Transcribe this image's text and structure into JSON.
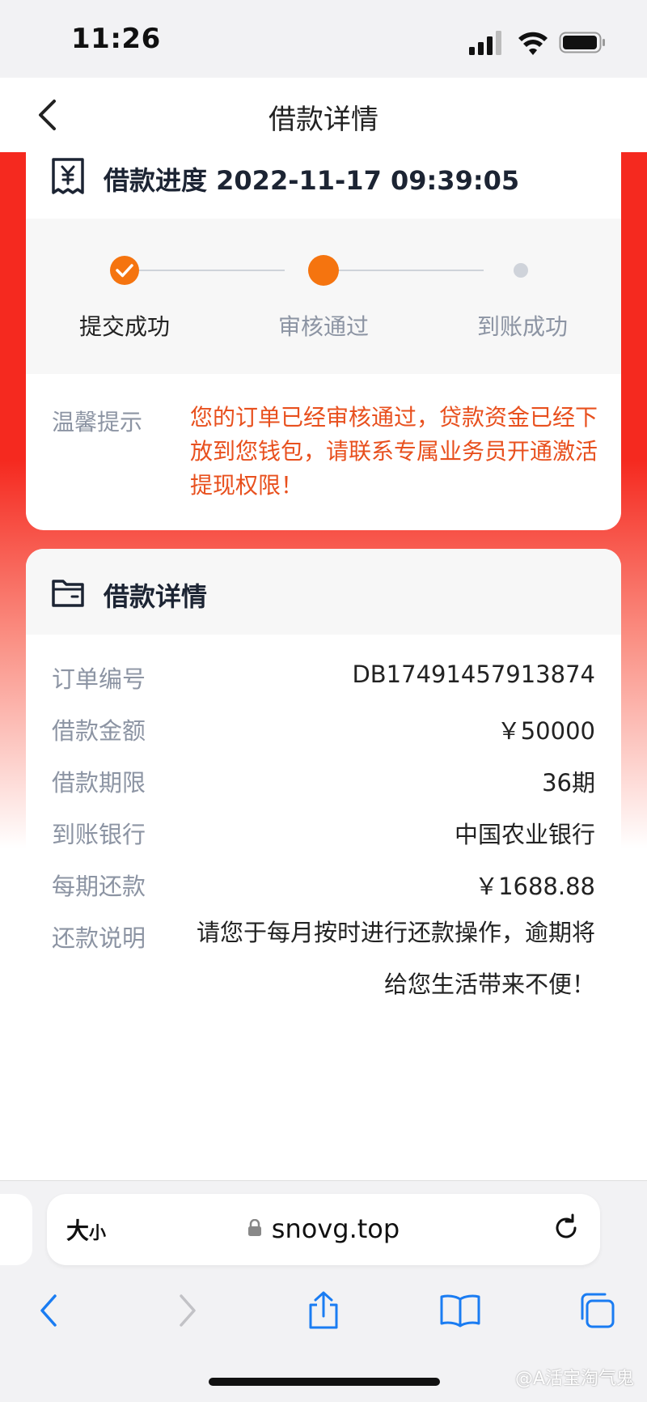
{
  "status": {
    "time": "11:26"
  },
  "nav": {
    "title": "借款详情"
  },
  "progress_card": {
    "title": "借款进度 2022-11-17 09:39:05",
    "steps": [
      {
        "label": "提交成功",
        "state": "done"
      },
      {
        "label": "审核通过",
        "state": "current"
      },
      {
        "label": "到账成功",
        "state": "pending"
      }
    ],
    "tip_label": "温馨提示",
    "tip_text": "您的订单已经审核通过，贷款资金已经下放到您钱包，请联系专属业务员开通激活提现权限！"
  },
  "detail_card": {
    "title": "借款详情",
    "rows": [
      {
        "label": "订单编号",
        "value": "DB17491457913874"
      },
      {
        "label": "借款金额",
        "value": "￥50000"
      },
      {
        "label": "借款期限",
        "value": "36期"
      },
      {
        "label": "到账银行",
        "value": "中国农业银行"
      },
      {
        "label": "每期还款",
        "value": "￥1688.88"
      },
      {
        "label": "还款说明",
        "value": "请您于每月按时进行还款操作，逾期将给您生活带来不便！"
      }
    ]
  },
  "browser": {
    "aa_big": "大",
    "aa_small": "小",
    "url": "snovg.top"
  },
  "watermark": "@A活宝淘气鬼",
  "colors": {
    "accent_orange": "#f5740f",
    "tip_red": "#e8501e",
    "background_red": "#f5291f",
    "ios_blue": "#1a7cf2"
  }
}
